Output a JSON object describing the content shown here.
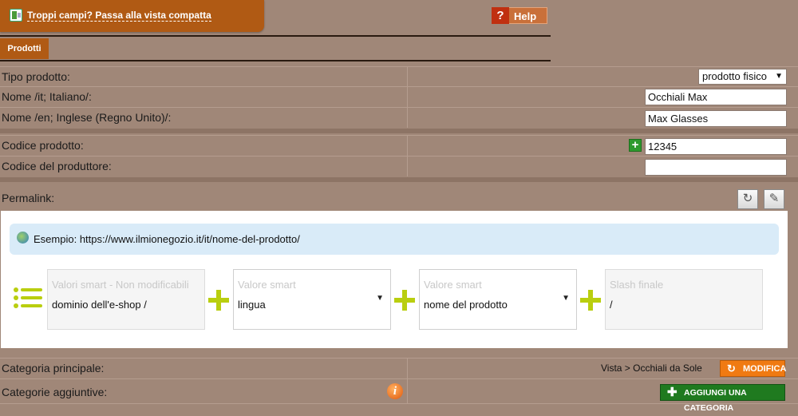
{
  "topbar": {
    "compact_link": "Troppi campi? Passa alla vista compatta",
    "help_icon": "?",
    "help_label": "Help"
  },
  "tab": {
    "label": "Prodotti"
  },
  "fields": {
    "tipo_label": "Tipo prodotto:",
    "tipo_value": "prodotto fisico",
    "nome_it_label": "Nome /it; Italiano/:",
    "nome_it_value": "Occhiali Max",
    "nome_en_label": "Nome /en; Inglese (Regno Unito)/:",
    "nome_en_value": "Max Glasses",
    "codice_label": "Codice prodotto:",
    "codice_value": "12345",
    "codice_prod_label": "Codice del produttore:",
    "codice_prod_value": "",
    "permalink_label": "Permalink:"
  },
  "permalink": {
    "example_label": "Esempio:",
    "example_url": "https://www.ilmionegozio.it/it/nome-del-prodotto/",
    "boxes": [
      {
        "placeholder": "Valori smart - Non modificabili",
        "value": "dominio dell'e-shop /"
      },
      {
        "placeholder": "Valore smart",
        "value": "lingua"
      },
      {
        "placeholder": "Valore smart",
        "value": "nome del prodotto"
      },
      {
        "placeholder": "Slash finale",
        "value": "/"
      }
    ]
  },
  "categories": {
    "main_label": "Categoria principale:",
    "main_value": "Vista > Occhiali da Sole",
    "modify_label": "MODIFICA",
    "extra_label": "Categorie aggiuntive:",
    "add_label": "AGGIUNGI UNA CATEGORIA"
  },
  "icons": {
    "topbar": "grid-view-icon",
    "help": "question-icon",
    "add_code": "plus-icon",
    "refresh": "refresh-icon",
    "edit": "pencil-icon",
    "globe": "globe-icon",
    "list": "list-icon",
    "info": "info-icon"
  }
}
